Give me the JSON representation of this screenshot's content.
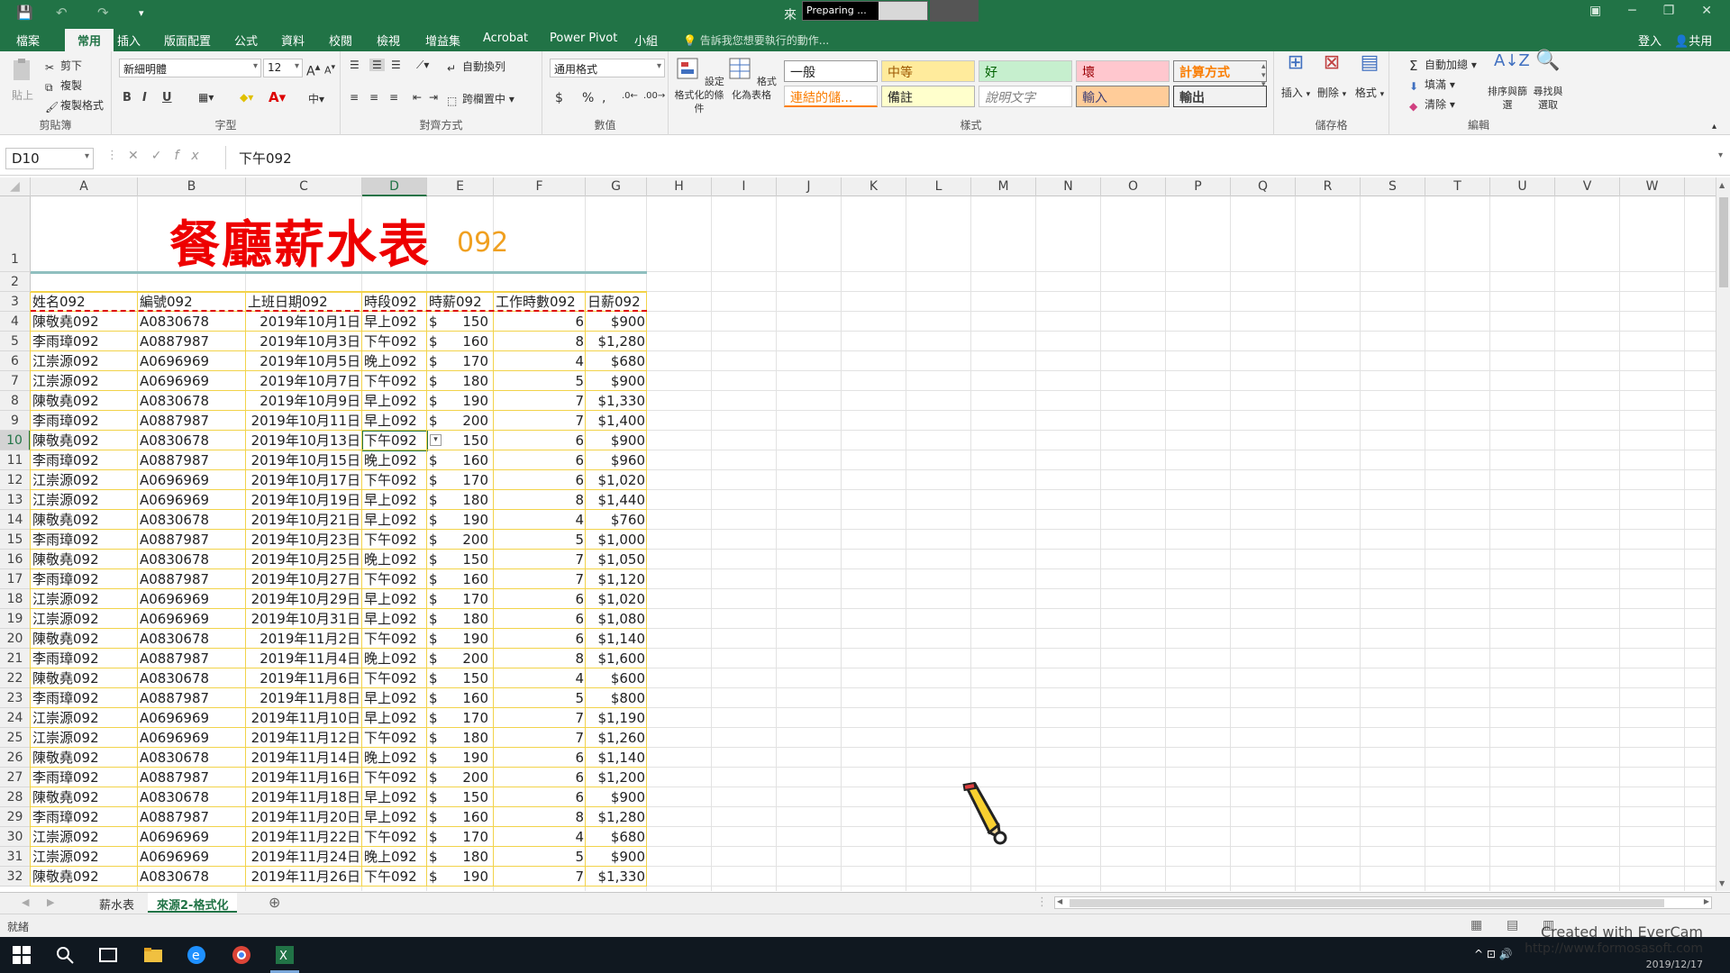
{
  "titlebar": {
    "title": "來",
    "preparing": "Preparing ...",
    "qat_save": "💾",
    "qat_undo": "↶",
    "qat_redo": "↷",
    "qat_more": "▾"
  },
  "tabs": [
    "檔案",
    "常用",
    "插入",
    "版面配置",
    "公式",
    "資料",
    "校閱",
    "檢視",
    "增益集",
    "Acrobat",
    "Power Pivot",
    "小組"
  ],
  "tellme": "告訴我您想要執行的動作...",
  "account": {
    "signin": "登入",
    "share": "共用"
  },
  "ribbon": {
    "clipboard": {
      "paste": "貼上",
      "cut": "剪下",
      "copy": "複製",
      "format_painter": "複製格式",
      "label": "剪貼簿"
    },
    "font": {
      "name": "新細明體",
      "size": "12",
      "bold": "B",
      "italic": "I",
      "underline": "U",
      "label": "字型"
    },
    "alignment": {
      "wrap": "自動換列",
      "merge": "跨欄置中",
      "label": "對齊方式"
    },
    "number": {
      "format": "通用格式",
      "currency": "$",
      "percent": "%",
      "comma": ",",
      "label": "數值"
    },
    "cond_format": "設定格式化的條件",
    "format_table": "格式化為表格",
    "styles": {
      "general": "一般",
      "neutral": "中等",
      "good": "好",
      "bad": "壞",
      "calc": "計算方式",
      "hyperlink": "連結的儲...",
      "note": "備註",
      "explanatory": "說明文字",
      "input": "輸入",
      "output": "輸出",
      "label": "樣式"
    },
    "cells": {
      "insert": "插入",
      "delete": "刪除",
      "format": "格式",
      "label": "儲存格"
    },
    "editing": {
      "autosum": "自動加總",
      "fill": "填滿",
      "clear": "清除",
      "sort": "排序與篩選",
      "find": "尋找與選取",
      "label": "編輯"
    }
  },
  "formula": {
    "namebox": "D10",
    "fx": "fx",
    "value": "下午092"
  },
  "columns": [
    "A",
    "B",
    "C",
    "D",
    "E",
    "F",
    "G",
    "H",
    "I",
    "J",
    "K",
    "L",
    "M",
    "N",
    "O",
    "P",
    "Q",
    "R",
    "S",
    "T",
    "U",
    "V",
    "W"
  ],
  "sheet": {
    "title": "餐廳薪水表",
    "title_suffix": "092",
    "headers": [
      "姓名092",
      "編號092",
      "上班日期092",
      "時段092",
      "時薪092",
      "工作時數092",
      "日薪092"
    ],
    "rows": [
      [
        "陳敬堯092",
        "A0830678",
        "2019年10月1日",
        "早上092",
        "$",
        "150",
        "6",
        "$900"
      ],
      [
        "李雨璋092",
        "A0887987",
        "2019年10月3日",
        "下午092",
        "$",
        "160",
        "8",
        "$1,280"
      ],
      [
        "江崇源092",
        "A0696969",
        "2019年10月5日",
        "晚上092",
        "$",
        "170",
        "4",
        "$680"
      ],
      [
        "江崇源092",
        "A0696969",
        "2019年10月7日",
        "下午092",
        "$",
        "180",
        "5",
        "$900"
      ],
      [
        "陳敬堯092",
        "A0830678",
        "2019年10月9日",
        "早上092",
        "$",
        "190",
        "7",
        "$1,330"
      ],
      [
        "李雨璋092",
        "A0887987",
        "2019年10月11日",
        "早上092",
        "$",
        "200",
        "7",
        "$1,400"
      ],
      [
        "陳敬堯092",
        "A0830678",
        "2019年10月13日",
        "下午092",
        "",
        "150",
        "6",
        "$900"
      ],
      [
        "李雨璋092",
        "A0887987",
        "2019年10月15日",
        "晚上092",
        "$",
        "160",
        "6",
        "$960"
      ],
      [
        "江崇源092",
        "A0696969",
        "2019年10月17日",
        "下午092",
        "$",
        "170",
        "6",
        "$1,020"
      ],
      [
        "江崇源092",
        "A0696969",
        "2019年10月19日",
        "早上092",
        "$",
        "180",
        "8",
        "$1,440"
      ],
      [
        "陳敬堯092",
        "A0830678",
        "2019年10月21日",
        "早上092",
        "$",
        "190",
        "4",
        "$760"
      ],
      [
        "李雨璋092",
        "A0887987",
        "2019年10月23日",
        "下午092",
        "$",
        "200",
        "5",
        "$1,000"
      ],
      [
        "陳敬堯092",
        "A0830678",
        "2019年10月25日",
        "晚上092",
        "$",
        "150",
        "7",
        "$1,050"
      ],
      [
        "李雨璋092",
        "A0887987",
        "2019年10月27日",
        "下午092",
        "$",
        "160",
        "7",
        "$1,120"
      ],
      [
        "江崇源092",
        "A0696969",
        "2019年10月29日",
        "早上092",
        "$",
        "170",
        "6",
        "$1,020"
      ],
      [
        "江崇源092",
        "A0696969",
        "2019年10月31日",
        "早上092",
        "$",
        "180",
        "6",
        "$1,080"
      ],
      [
        "陳敬堯092",
        "A0830678",
        "2019年11月2日",
        "下午092",
        "$",
        "190",
        "6",
        "$1,140"
      ],
      [
        "李雨璋092",
        "A0887987",
        "2019年11月4日",
        "晚上092",
        "$",
        "200",
        "8",
        "$1,600"
      ],
      [
        "陳敬堯092",
        "A0830678",
        "2019年11月6日",
        "下午092",
        "$",
        "150",
        "4",
        "$600"
      ],
      [
        "李雨璋092",
        "A0887987",
        "2019年11月8日",
        "早上092",
        "$",
        "160",
        "5",
        "$800"
      ],
      [
        "江崇源092",
        "A0696969",
        "2019年11月10日",
        "早上092",
        "$",
        "170",
        "7",
        "$1,190"
      ],
      [
        "江崇源092",
        "A0696969",
        "2019年11月12日",
        "下午092",
        "$",
        "180",
        "7",
        "$1,260"
      ],
      [
        "陳敬堯092",
        "A0830678",
        "2019年11月14日",
        "晚上092",
        "$",
        "190",
        "6",
        "$1,140"
      ],
      [
        "李雨璋092",
        "A0887987",
        "2019年11月16日",
        "下午092",
        "$",
        "200",
        "6",
        "$1,200"
      ],
      [
        "陳敬堯092",
        "A0830678",
        "2019年11月18日",
        "早上092",
        "$",
        "150",
        "6",
        "$900"
      ],
      [
        "李雨璋092",
        "A0887987",
        "2019年11月20日",
        "早上092",
        "$",
        "160",
        "8",
        "$1,280"
      ],
      [
        "江崇源092",
        "A0696969",
        "2019年11月22日",
        "下午092",
        "$",
        "170",
        "4",
        "$680"
      ],
      [
        "江崇源092",
        "A0696969",
        "2019年11月24日",
        "晚上092",
        "$",
        "180",
        "5",
        "$900"
      ],
      [
        "陳敬堯092",
        "A0830678",
        "2019年11月26日",
        "下午092",
        "$",
        "190",
        "7",
        "$1,330"
      ]
    ]
  },
  "sheet_tabs": [
    "薪水表",
    "來源2-格式化"
  ],
  "status": "就緒",
  "watermark": {
    "line1": "Created with EverCam",
    "line2": "http://www.formosasoft.com",
    "date": "2019/12/17"
  },
  "colors": {
    "excel_green": "#217346",
    "title_red": "#ee0000",
    "title_orange": "#f0a020",
    "border_yellow": "#f2d34a"
  }
}
